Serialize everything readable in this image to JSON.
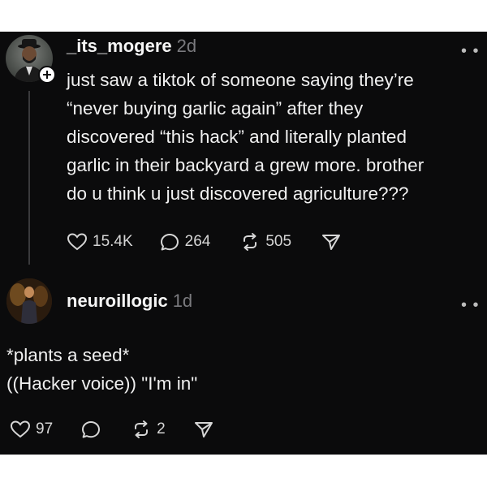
{
  "post": {
    "username": "_its_mogere",
    "time": "2d",
    "text_lines": [
      "just saw a tiktok of someone saying they’re",
      "“never buying garlic again” after they",
      "discovered “this hack” and literally planted",
      "garlic in their backyard a grew more. brother",
      "do u think u just discovered agriculture???"
    ],
    "likes": "15.4K",
    "replies": "264",
    "reposts": "505",
    "more_label": "• •"
  },
  "reply": {
    "username": "neuroillogic",
    "time": "1d",
    "text_lines": [
      "*plants a seed*",
      "((Hacker voice)) \"I'm in\""
    ],
    "likes": "97",
    "reposts": "2",
    "more_label": "• •"
  },
  "icons": {
    "like": "heart-icon",
    "reply": "comment-bubble-icon",
    "repost": "repost-arrows-icon",
    "share": "send-icon",
    "follow": "plus-icon",
    "more": "more-dots-icon"
  },
  "colors": {
    "background": "#0b0b0c",
    "text": "#f0f0f0",
    "muted": "#7a7a7e",
    "icon": "#d6d6d6"
  }
}
